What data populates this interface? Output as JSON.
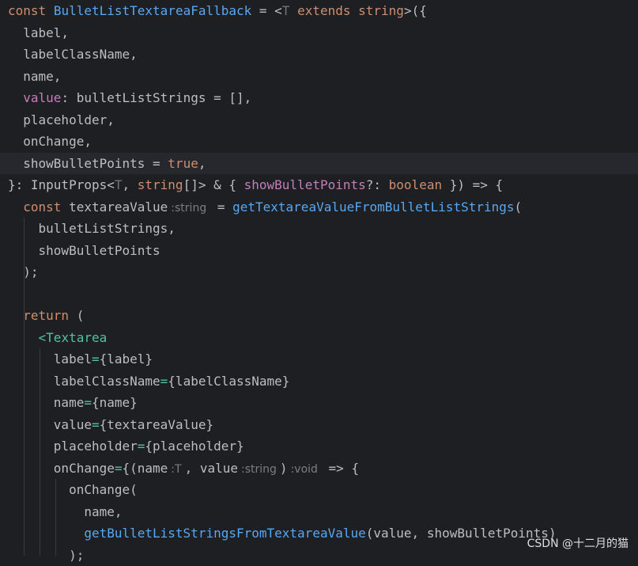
{
  "code": {
    "l1": {
      "kw_const": "const",
      "fn_name": "BulletListTextareaFallback",
      "eq_lt": " = <",
      "type_T": "T",
      "kw_extends": " extends string",
      "punct": ">({"
    },
    "l2": {
      "text": "label,"
    },
    "l3": {
      "text": "labelClassName,"
    },
    "l4": {
      "text": "name,"
    },
    "l5": {
      "prop": "value",
      "rest": ": bulletListStrings = [],"
    },
    "l6": {
      "text": "placeholder,"
    },
    "l7": {
      "text": "onChange,"
    },
    "l8": {
      "text": "showBulletPoints = ",
      "kw_true": "true",
      "comma": ","
    },
    "l9": {
      "a": "}: InputProps<",
      "type_T": "T",
      "b": ", ",
      "kw_string": "string",
      "c": "[]> & { ",
      "prop": "showBulletPoints",
      "d": "?: ",
      "kw_boolean": "boolean",
      "e": " }) => {"
    },
    "l10": {
      "kw_const": "const",
      "name": " textareaValue",
      "hint": ":string",
      "eq": " = ",
      "fn": "getTextareaValueFromBulletListStrings",
      "paren": "("
    },
    "l11": {
      "text": "bulletListStrings,"
    },
    "l12": {
      "text": "showBulletPoints"
    },
    "l13": {
      "text": ");"
    },
    "l15": {
      "kw_return": "return",
      "paren": " ("
    },
    "l16": {
      "lt": "<",
      "tag": "Textarea"
    },
    "l17": {
      "attr": "label",
      "eq": "=",
      "val": "{label}"
    },
    "l18": {
      "attr": "labelClassName",
      "eq": "=",
      "val": "{labelClassName}"
    },
    "l19": {
      "attr": "name",
      "eq": "=",
      "val": "{name}"
    },
    "l20": {
      "attr": "value",
      "eq": "=",
      "val": "{textareaValue}"
    },
    "l21": {
      "attr": "placeholder",
      "eq": "=",
      "val": "{placeholder}"
    },
    "l22": {
      "attr": "onChange",
      "eq": "=",
      "a": "{(name",
      "hint1": ":T",
      "b": ", value",
      "hint2": ":string",
      "c": ")",
      "hint3": ":void",
      "d": " => {"
    },
    "l23": {
      "text": "onChange("
    },
    "l24": {
      "text": "name,"
    },
    "l25": {
      "fn": "getBulletListStringsFromTextareaValue",
      "rest": "(value, showBulletPoints)"
    },
    "l26": {
      "text": ");"
    }
  },
  "watermark": "CSDN @十二月的猫",
  "colors": {
    "background": "#1e1f22",
    "keyword": "#cf8e6d",
    "function": "#56a8f5",
    "tag": "#52c2a0",
    "property": "#c77dbb"
  }
}
